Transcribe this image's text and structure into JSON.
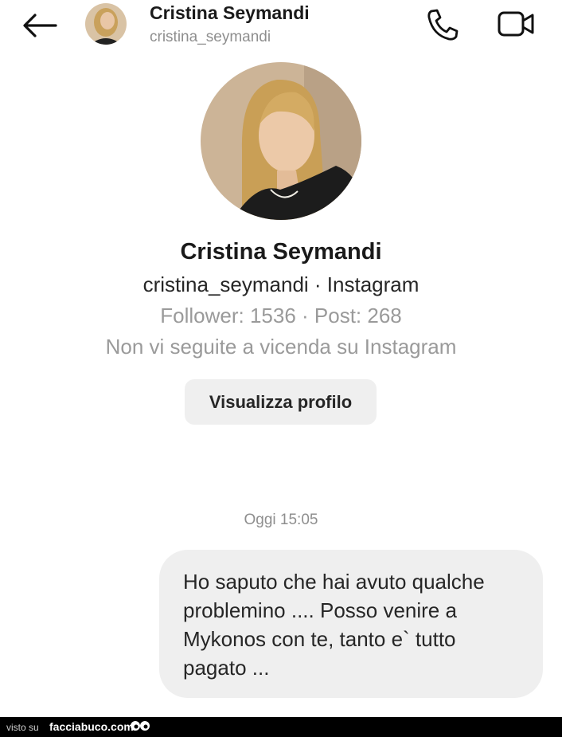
{
  "header": {
    "name": "Cristina Seymandi",
    "username": "cristina_seymandi"
  },
  "profile": {
    "name": "Cristina Seymandi",
    "subtitle": "cristina_seymandi · Instagram",
    "stats": "Follower: 1536 · Post: 268",
    "mutual": "Non vi seguite a vicenda su Instagram",
    "view_button": "Visualizza profilo"
  },
  "chat": {
    "timestamp": "Oggi 15:05",
    "messages": [
      {
        "text": "Ho saputo che hai avuto qualche problemino .... Posso venire a Mykonos con te, tanto e` tutto pagato ..."
      }
    ]
  },
  "footer": {
    "prefix": "visto su",
    "brand": "facciabuco.com"
  },
  "icons": [
    "back-arrow-icon",
    "phone-icon",
    "video-camera-icon"
  ],
  "colors": {
    "bubble": "#efefef",
    "muted_text": "#9a9a9a",
    "footer_bg": "#000000"
  }
}
